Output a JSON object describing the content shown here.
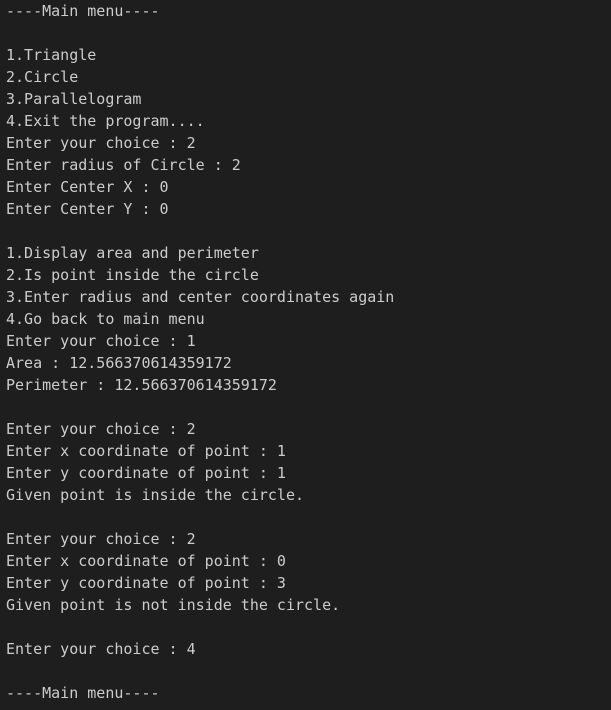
{
  "terminal": {
    "lines": [
      "----Main menu----",
      "",
      "1.Triangle",
      "2.Circle",
      "3.Parallelogram",
      "4.Exit the program....",
      "Enter your choice : 2",
      "Enter radius of Circle : 2",
      "Enter Center X : 0",
      "Enter Center Y : 0",
      "",
      "1.Display area and perimeter",
      "2.Is point inside the circle",
      "3.Enter radius and center coordinates again",
      "4.Go back to main menu",
      "Enter your choice : 1",
      "Area : 12.566370614359172",
      "Perimeter : 12.566370614359172",
      "",
      "Enter your choice : 2",
      "Enter x coordinate of point : 1",
      "Enter y coordinate of point : 1",
      "Given point is inside the circle.",
      "",
      "Enter your choice : 2",
      "Enter x coordinate of point : 0",
      "Enter y coordinate of point : 3",
      "Given point is not inside the circle.",
      "",
      "Enter your choice : 4",
      "",
      "----Main menu----"
    ]
  },
  "colors": {
    "background": "#1e1e1e",
    "text": "#cccccc"
  }
}
